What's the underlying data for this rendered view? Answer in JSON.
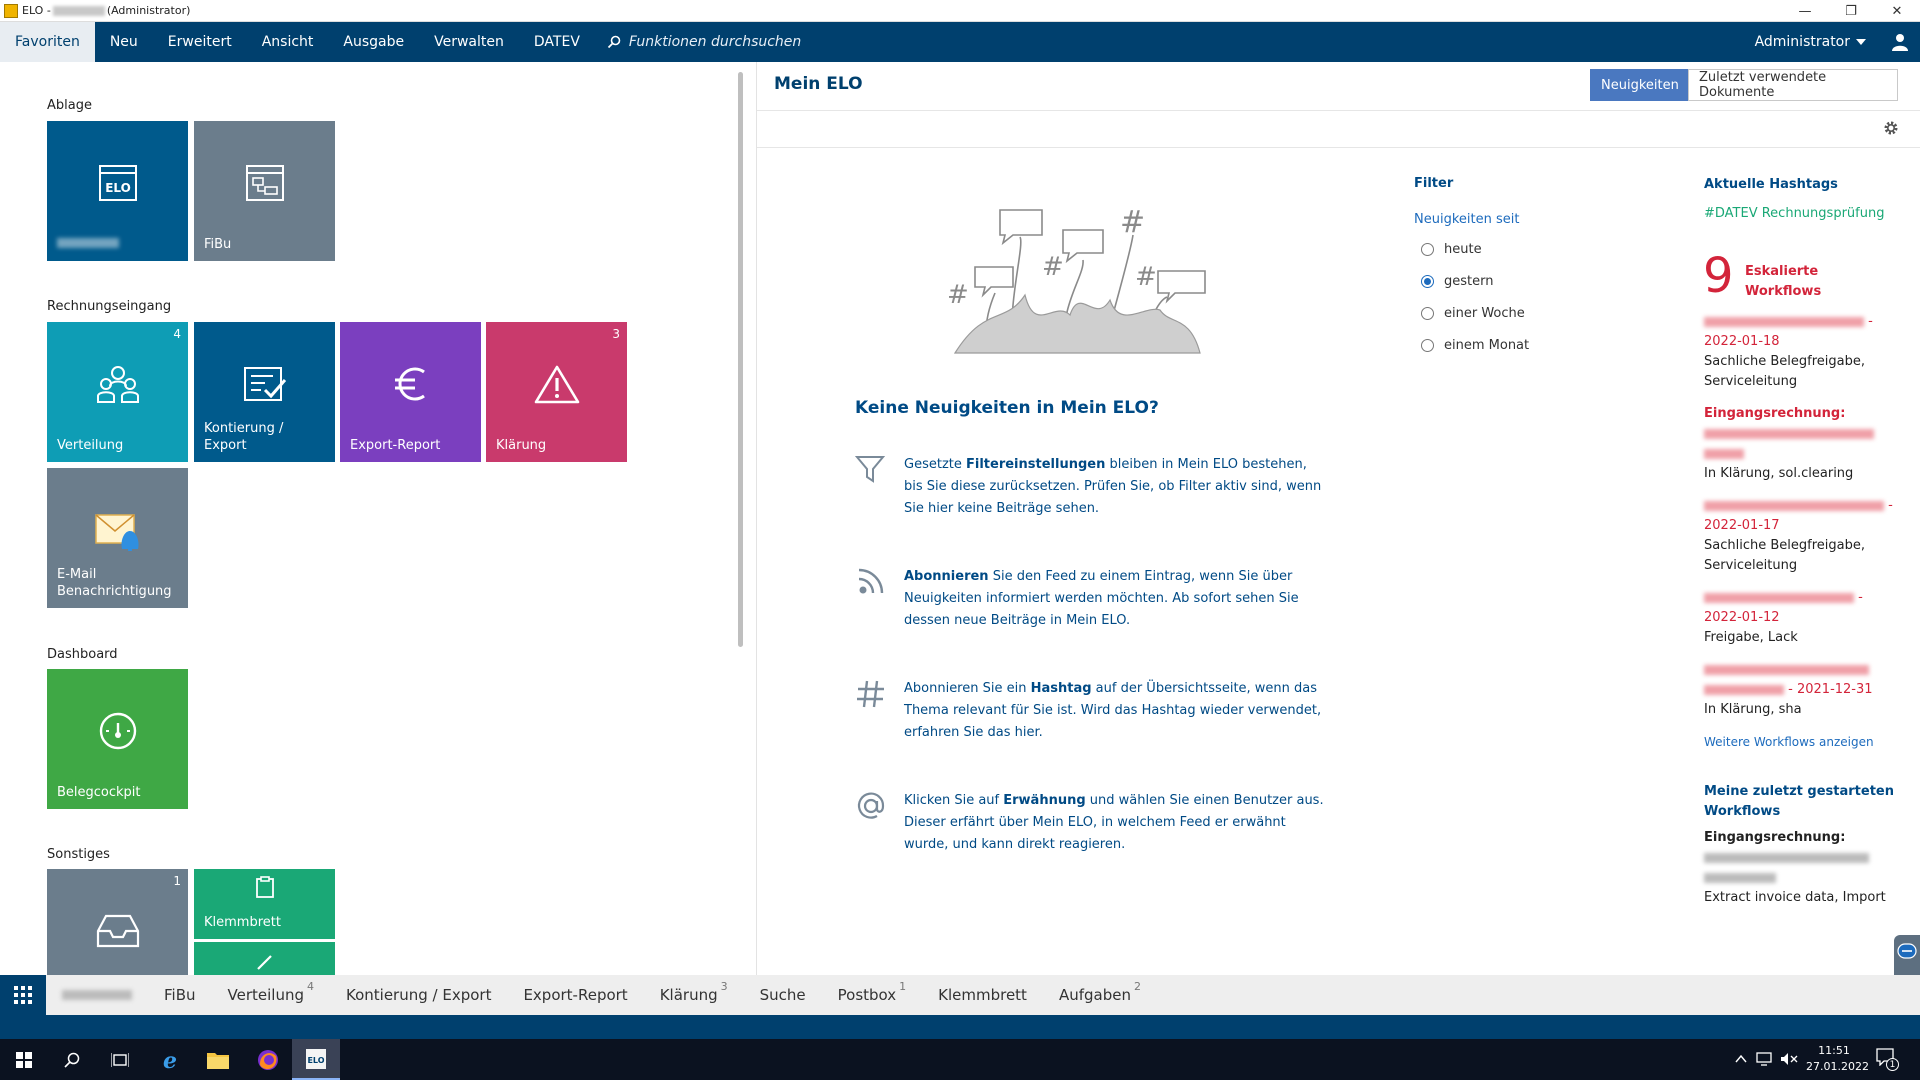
{
  "window": {
    "app_name": "ELO - ",
    "title_redacted": "",
    "title_suffix": "(Administrator)",
    "controls": {
      "minimize": "—",
      "maximize": "❐",
      "close": "✕"
    }
  },
  "ribbon": {
    "tabs": [
      {
        "label": "Favoriten",
        "active": true
      },
      {
        "label": "Neu"
      },
      {
        "label": "Erweitert"
      },
      {
        "label": "Ansicht"
      },
      {
        "label": "Ausgabe"
      },
      {
        "label": "Verwalten"
      },
      {
        "label": "DATEV"
      }
    ],
    "search_placeholder": "Funktionen durchsuchen",
    "user": "Administrator"
  },
  "tiles": {
    "groups": {
      "ablage": "Ablage",
      "rechnungseingang": "Rechnungseingang",
      "dashboard": "Dashboard",
      "sonstiges": "Sonstiges"
    },
    "ablage": [
      {
        "label": "",
        "icon": "elo-archive-icon",
        "color": "#005a8c"
      },
      {
        "label": "FiBu",
        "icon": "folder-structure-icon",
        "color": "#6b7d8c"
      }
    ],
    "rechnungseingang": [
      {
        "label": "Verteilung",
        "badge": "4",
        "icon": "people-icon",
        "color": "#0e9db5"
      },
      {
        "label": "Kontierung / Export",
        "icon": "checklist-icon",
        "color": "#005a8c"
      },
      {
        "label": "Export-Report",
        "icon": "euro-icon",
        "color": "#7b3fbf"
      },
      {
        "label": "Klärung",
        "badge": "3",
        "icon": "warning-icon",
        "color": "#c93a6c"
      },
      {
        "label": "E-Mail Benachrichtigung",
        "icon": "mail-bell-icon",
        "color": "#6b7d8c"
      }
    ],
    "dashboard": [
      {
        "label": "Belegcockpit",
        "icon": "gauge-icon",
        "color": "#3fa845"
      }
    ],
    "sonstiges": [
      {
        "label": "",
        "badge": "1",
        "icon": "inbox-icon",
        "color": "#6b7d8c"
      },
      {
        "label": "Klemmbrett",
        "icon": "clipboard-icon",
        "color": "#1aa876"
      },
      {
        "label": "",
        "icon": "pen-icon",
        "color": "#1aa876"
      }
    ]
  },
  "main": {
    "title": "Mein ELO",
    "tabs": [
      {
        "label": "Neuigkeiten",
        "active": true
      },
      {
        "label": "Zuletzt verwendete Dokumente"
      }
    ],
    "empty": {
      "heading": "Keine Neuigkeiten in Mein ELO?",
      "tips": [
        {
          "icon": "filter-icon",
          "pre": "Gesetzte ",
          "bold": "Filtereinstellungen",
          "post": " bleiben in Mein ELO bestehen, bis Sie diese zurücksetzen. Prüfen Sie, ob Filter aktiv sind, wenn Sie hier keine Beiträge sehen."
        },
        {
          "icon": "feed-icon",
          "pre": "",
          "bold": "Abonnieren",
          "post": " Sie den Feed zu einem Eintrag, wenn Sie über Neuigkeiten informiert werden möchten. Ab sofort sehen Sie dessen neue Beiträge in Mein ELO."
        },
        {
          "icon": "hashtag-icon",
          "pre": "Abonnieren Sie ein ",
          "bold": "Hashtag",
          "post": " auf der Übersichtsseite, wenn das Thema relevant für Sie ist. Wird das Hashtag wieder verwendet, erfahren Sie das hier."
        },
        {
          "icon": "mention-icon",
          "pre": "Klicken Sie auf ",
          "bold": "Erwähnung",
          "post": " und wählen Sie einen Benutzer aus. Dieser erfährt über Mein ELO, in welchem Feed er erwähnt wurde, und kann direkt reagieren."
        }
      ]
    },
    "filter": {
      "title": "Filter",
      "since_label": "Neuigkeiten seit",
      "options": [
        {
          "label": "heute",
          "selected": false
        },
        {
          "label": "gestern",
          "selected": true
        },
        {
          "label": "einer Woche",
          "selected": false
        },
        {
          "label": "einem Monat",
          "selected": false
        }
      ]
    },
    "hashtags": {
      "title": "Aktuelle Hashtags",
      "items": [
        "#DATEV Rechnungsprüfung"
      ]
    },
    "escalated": {
      "count": "9",
      "label_line1": "Eskalierte",
      "label_line2": "Workflows",
      "items": [
        {
          "date": "2022-01-18",
          "line1": "Sachliche Belegfreigabe,",
          "line2": "Serviceleitung"
        },
        {
          "title": "Eingangsrechnung:",
          "line1": "In Klärung, sol.clearing"
        },
        {
          "date": "2022-01-17",
          "line1": "Sachliche Belegfreigabe,",
          "line2": "Serviceleitung"
        },
        {
          "date": "2022-01-12",
          "line1": "Freigabe, Lack"
        },
        {
          "date": "2021-12-31",
          "line1": "In Klärung, sha"
        }
      ],
      "more_link": "Weitere Workflows anzeigen"
    },
    "started": {
      "title_line1": "Meine zuletzt gestarteten",
      "title_line2": "Workflows",
      "item_title": "Eingangsrechnung:",
      "item_status": "Extract invoice data, Import"
    },
    "settings_icon": "gear-icon"
  },
  "bottom_tabs": [
    {
      "label": ""
    },
    {
      "label": "FiBu"
    },
    {
      "label": "Verteilung",
      "badge": "4"
    },
    {
      "label": "Kontierung / Export"
    },
    {
      "label": "Export-Report"
    },
    {
      "label": "Klärung",
      "badge": "3"
    },
    {
      "label": "Suche"
    },
    {
      "label": "Postbox",
      "badge": "1"
    },
    {
      "label": "Klemmbrett"
    },
    {
      "label": "Aufgaben",
      "badge": "2"
    }
  ],
  "taskbar": {
    "time": "11:51",
    "date": "27.01.2022",
    "notification_count": "1"
  },
  "colors": {
    "brand": "#00406e",
    "link": "#1d6bbd",
    "alert": "#d3243a",
    "hashtag": "#1aa876"
  }
}
